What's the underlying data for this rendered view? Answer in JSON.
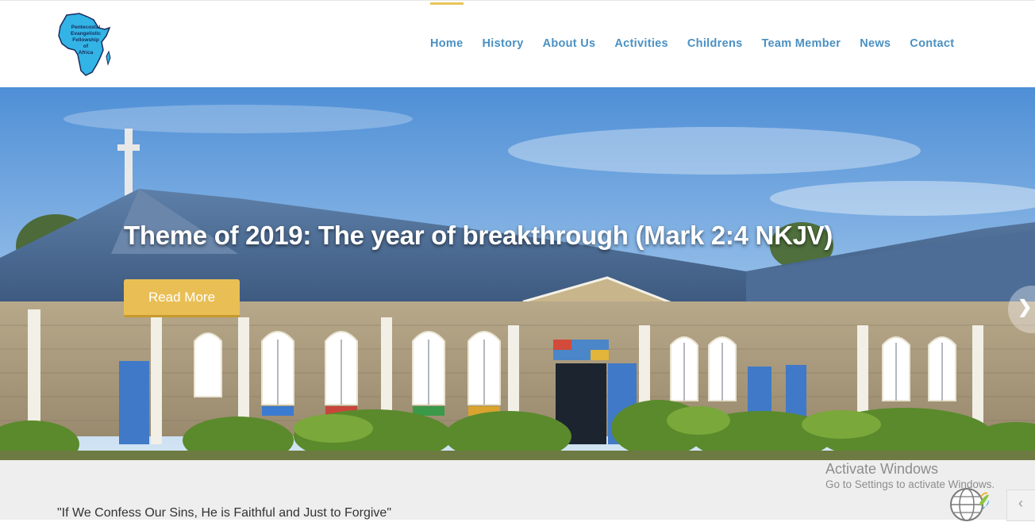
{
  "logo": {
    "text": "Pentecostal Evangelistic Fellowship of Africa",
    "lines": [
      "Pentecostal",
      "Evangelistic",
      "Fellowship",
      "of",
      "Africa"
    ]
  },
  "nav": {
    "items": [
      "Home",
      "History",
      "About Us",
      "Activities",
      "Childrens",
      "Team Member",
      "News",
      "Contact"
    ],
    "active": "Home"
  },
  "hero": {
    "title": "Theme of 2019: The year of breakthrough (Mark 2:4 NKJV)",
    "button": "Read More",
    "next_icon": "chevron-right-icon"
  },
  "content": {
    "quote": "\"If We Confess Our Sins, He is Faithful and Just to Forgive\""
  },
  "watermark": {
    "title": "Activate Windows",
    "subtitle": "Go to Settings to activate Windows."
  },
  "colors": {
    "nav": "#4a90c2",
    "accent": "#e8c45a",
    "button": "#e9bf55"
  }
}
